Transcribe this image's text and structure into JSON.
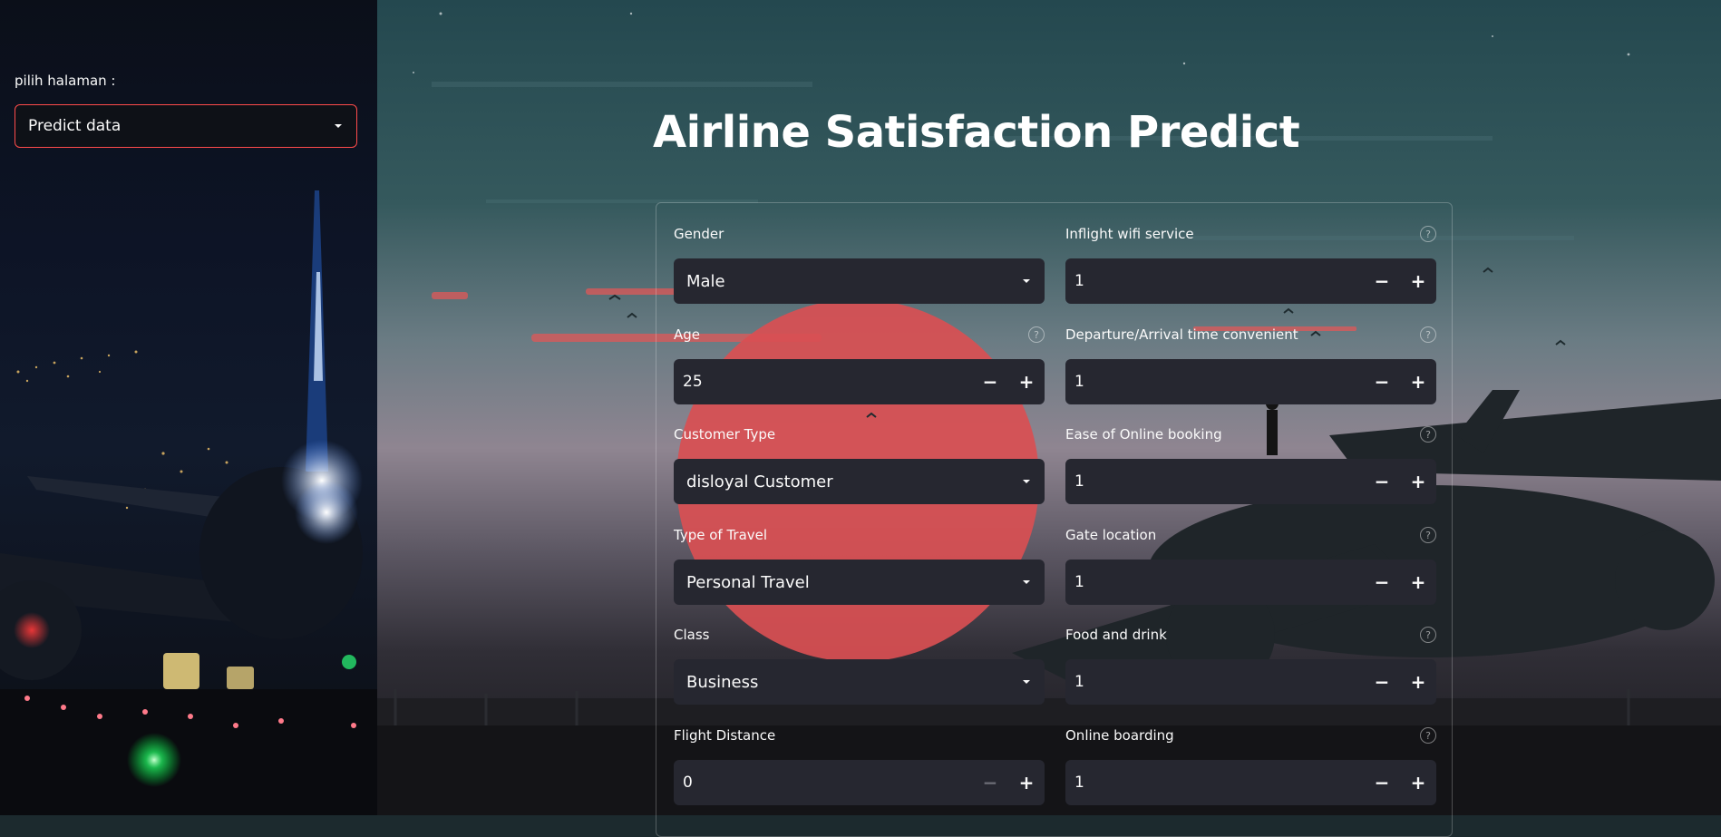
{
  "sidebar": {
    "label": "pilih halaman :",
    "selected": "Predict data"
  },
  "page": {
    "title": "Airline Satisfaction Predict"
  },
  "form": {
    "left": [
      {
        "label": "Gender",
        "type": "select",
        "value": "Male",
        "help": false
      },
      {
        "label": "Age",
        "type": "number",
        "value": "25",
        "help": true
      },
      {
        "label": "Customer Type",
        "type": "select",
        "value": "disloyal Customer",
        "help": false
      },
      {
        "label": "Type of Travel",
        "type": "select",
        "value": "Personal Travel",
        "help": false
      },
      {
        "label": "Class",
        "type": "select",
        "value": "Business",
        "help": false
      },
      {
        "label": "Flight Distance",
        "type": "number",
        "value": "0",
        "help": false,
        "minus_disabled": true
      }
    ],
    "right": [
      {
        "label": "Inflight wifi service",
        "type": "number",
        "value": "1",
        "help": true
      },
      {
        "label": "Departure/Arrival time convenient",
        "type": "number",
        "value": "1",
        "help": true
      },
      {
        "label": "Ease of Online booking",
        "type": "number",
        "value": "1",
        "help": true
      },
      {
        "label": "Gate location",
        "type": "number",
        "value": "1",
        "help": true
      },
      {
        "label": "Food and drink",
        "type": "number",
        "value": "1",
        "help": true
      },
      {
        "label": "Online boarding",
        "type": "number",
        "value": "1",
        "help": true
      }
    ]
  },
  "icons": {
    "dropdown": "chevron-down-icon",
    "help": "question-circle-icon",
    "minus": "minus-icon",
    "plus": "plus-icon"
  },
  "colors": {
    "accent": "#ff4b4b",
    "widget_bg": "#262730",
    "text": "#fafafa"
  }
}
